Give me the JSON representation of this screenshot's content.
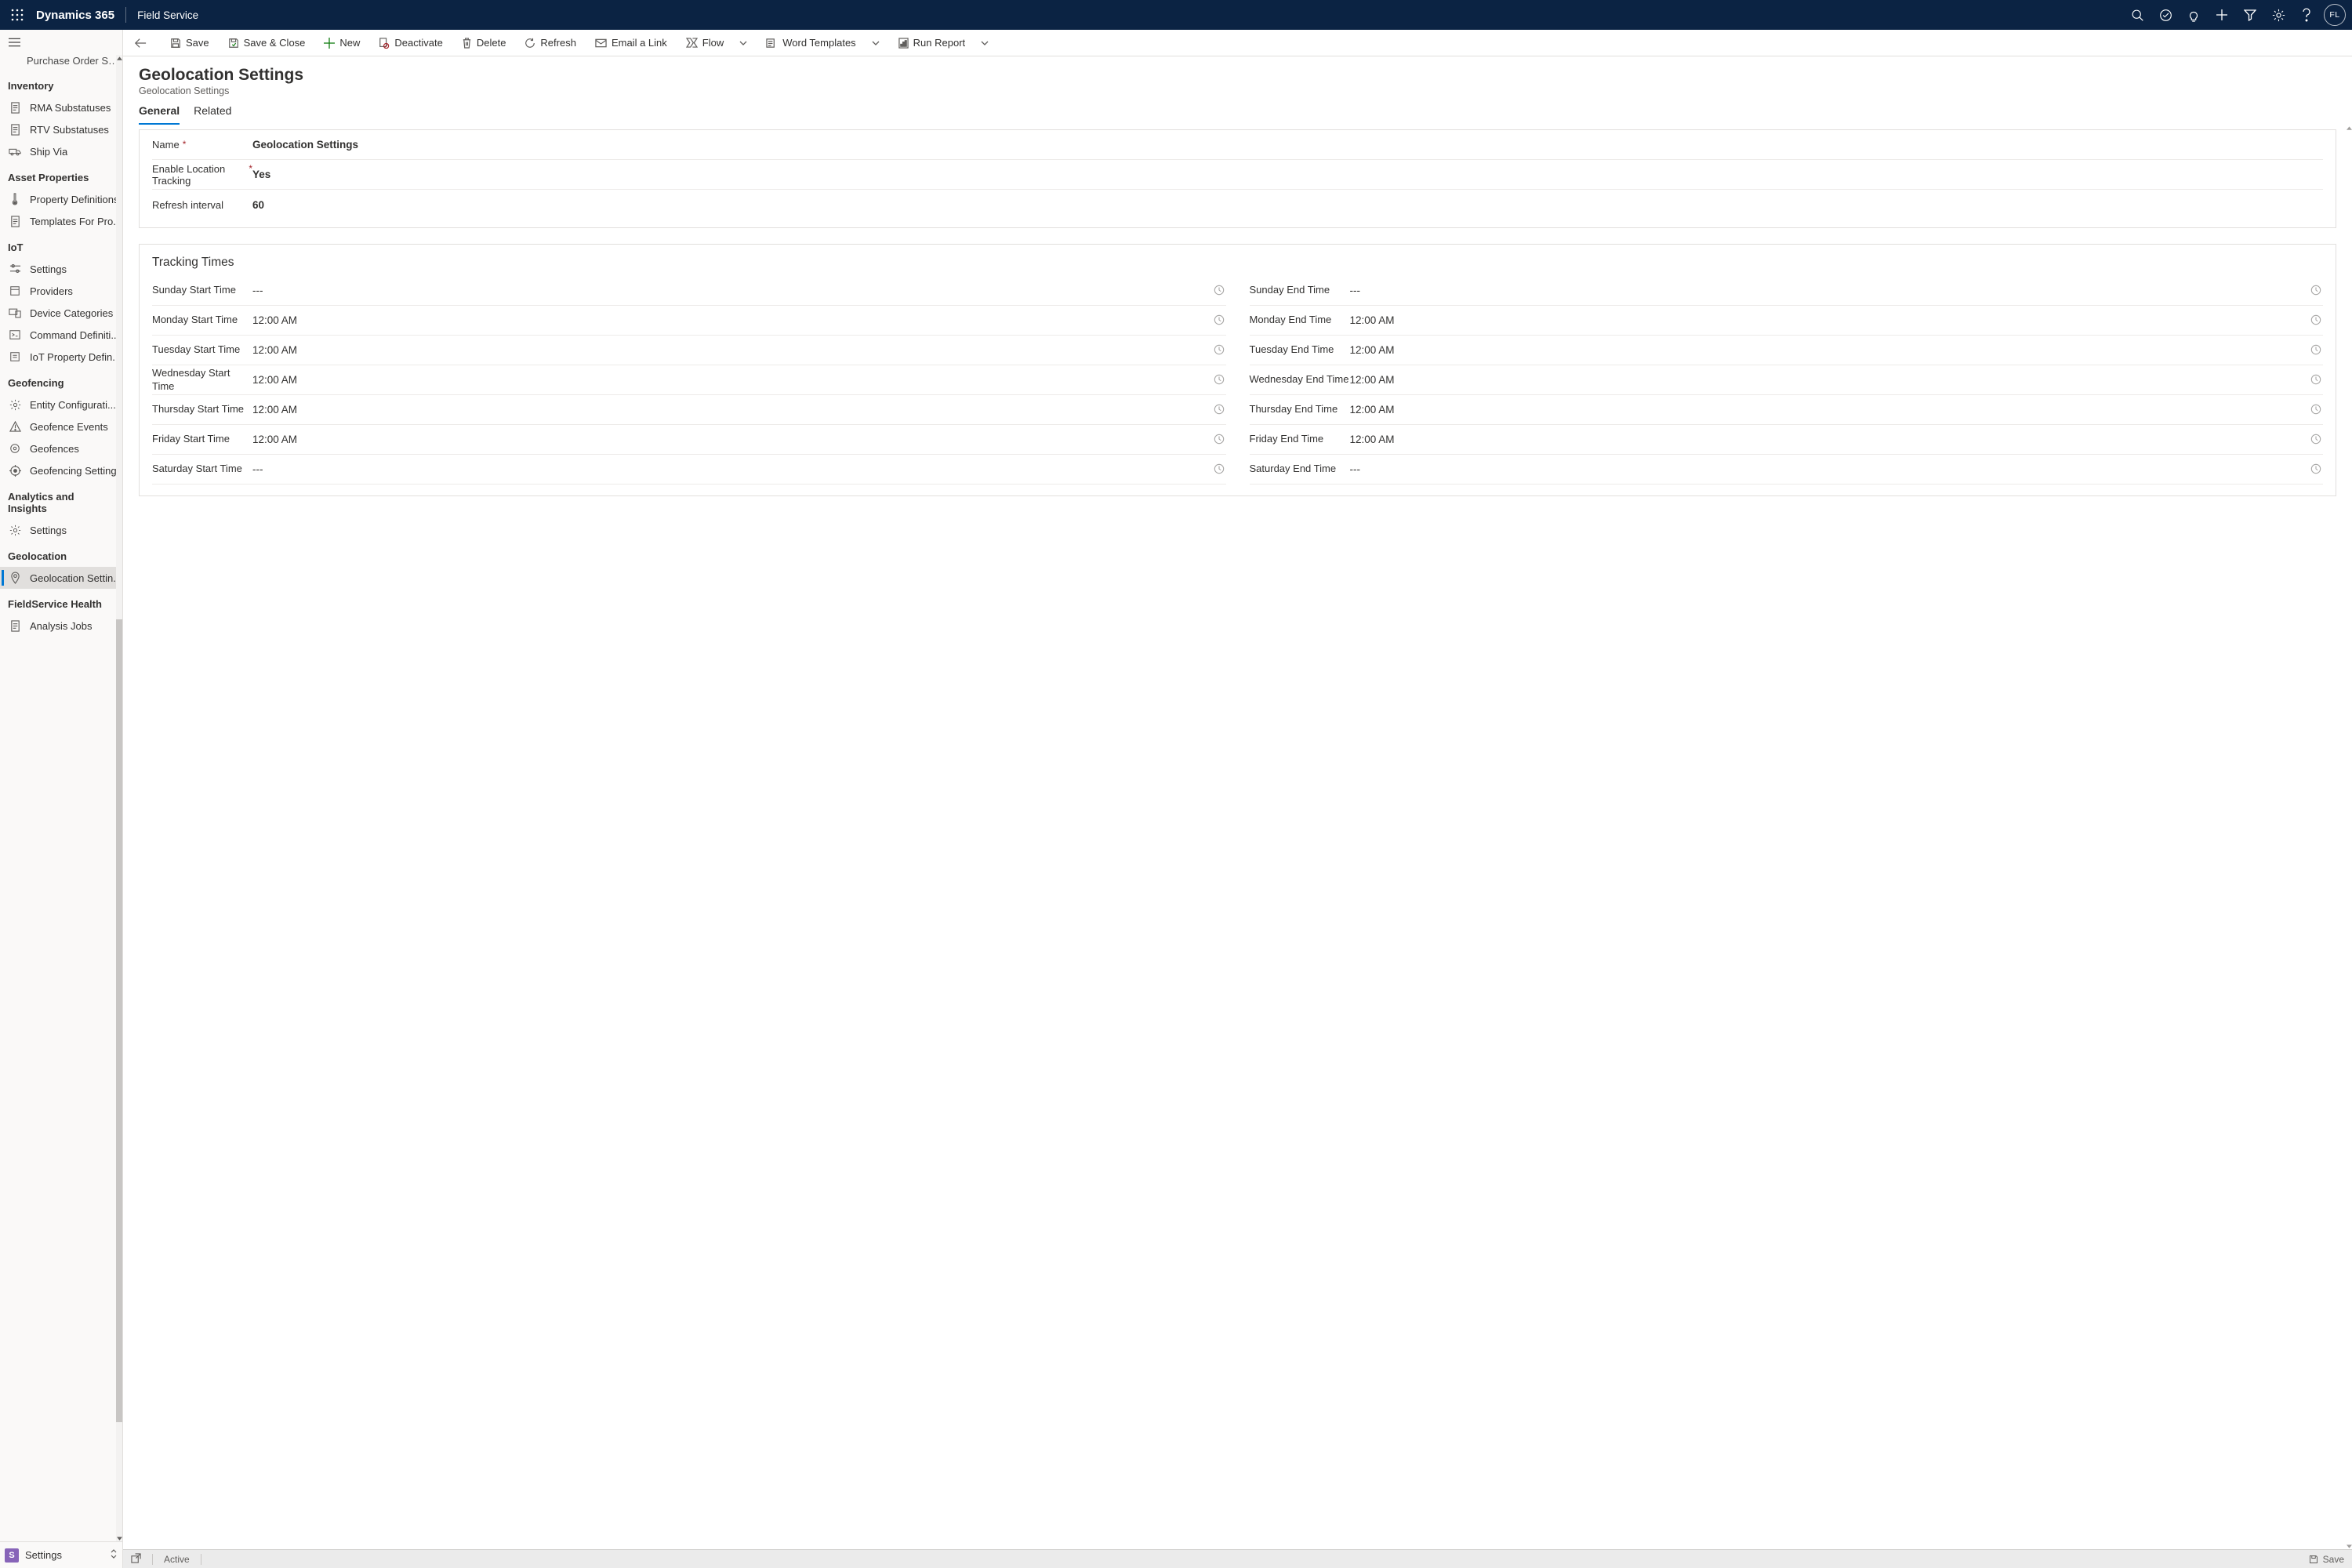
{
  "topbar": {
    "brand": "Dynamics 365",
    "app": "Field Service",
    "avatar": "FL"
  },
  "sidebar": {
    "truncated_top": "Purchase Order Su...",
    "groups": [
      {
        "title": "Inventory",
        "items": [
          {
            "label": "RMA Substatuses",
            "icon": "doc"
          },
          {
            "label": "RTV Substatuses",
            "icon": "doc"
          },
          {
            "label": "Ship Via",
            "icon": "ship"
          }
        ]
      },
      {
        "title": "Asset Properties",
        "items": [
          {
            "label": "Property Definitions",
            "icon": "thermo"
          },
          {
            "label": "Templates For Pro...",
            "icon": "doc"
          }
        ]
      },
      {
        "title": "IoT",
        "items": [
          {
            "label": "Settings",
            "icon": "sliders"
          },
          {
            "label": "Providers",
            "icon": "box"
          },
          {
            "label": "Device Categories",
            "icon": "devices"
          },
          {
            "label": "Command Definiti...",
            "icon": "cmd"
          },
          {
            "label": "IoT Property Defin...",
            "icon": "props"
          }
        ]
      },
      {
        "title": "Geofencing",
        "items": [
          {
            "label": "Entity Configurati...",
            "icon": "gear"
          },
          {
            "label": "Geofence Events",
            "icon": "warn"
          },
          {
            "label": "Geofences",
            "icon": "fence"
          },
          {
            "label": "Geofencing Settings",
            "icon": "target"
          }
        ]
      },
      {
        "title": "Analytics and Insights",
        "items": [
          {
            "label": "Settings",
            "icon": "gear"
          }
        ]
      },
      {
        "title": "Geolocation",
        "items": [
          {
            "label": "Geolocation Settin...",
            "icon": "geo",
            "active": true
          }
        ]
      },
      {
        "title": "FieldService Health",
        "items": [
          {
            "label": "Analysis Jobs",
            "icon": "doc"
          }
        ]
      }
    ],
    "area": {
      "badge": "S",
      "name": "Settings"
    }
  },
  "commands": {
    "save": "Save",
    "save_close": "Save & Close",
    "new": "New",
    "deactivate": "Deactivate",
    "delete": "Delete",
    "refresh": "Refresh",
    "email_link": "Email a Link",
    "flow": "Flow",
    "word_templates": "Word Templates",
    "run_report": "Run Report"
  },
  "header": {
    "title": "Geolocation Settings",
    "subtitle": "Geolocation Settings"
  },
  "tabs": {
    "general": "General",
    "related": "Related"
  },
  "form": {
    "name_label": "Name",
    "name_value": "Geolocation Settings",
    "enable_label": "Enable Location Tracking",
    "enable_value": "Yes",
    "refresh_label": "Refresh interval",
    "refresh_value": "60"
  },
  "tracking": {
    "section": "Tracking Times",
    "left": [
      {
        "label": "Sunday Start Time",
        "value": "---"
      },
      {
        "label": "Monday Start Time",
        "value": "12:00 AM"
      },
      {
        "label": "Tuesday Start Time",
        "value": "12:00 AM"
      },
      {
        "label": "Wednesday Start Time",
        "value": "12:00 AM"
      },
      {
        "label": "Thursday Start Time",
        "value": "12:00 AM"
      },
      {
        "label": "Friday Start Time",
        "value": "12:00 AM"
      },
      {
        "label": "Saturday Start Time",
        "value": "---"
      }
    ],
    "right": [
      {
        "label": "Sunday End Time",
        "value": "---"
      },
      {
        "label": "Monday End Time",
        "value": "12:00 AM"
      },
      {
        "label": "Tuesday End Time",
        "value": "12:00 AM"
      },
      {
        "label": "Wednesday End Time",
        "value": "12:00 AM"
      },
      {
        "label": "Thursday End Time",
        "value": "12:00 AM"
      },
      {
        "label": "Friday End Time",
        "value": "12:00 AM"
      },
      {
        "label": "Saturday End Time",
        "value": "---"
      }
    ]
  },
  "status": {
    "state": "Active",
    "save": "Save"
  }
}
